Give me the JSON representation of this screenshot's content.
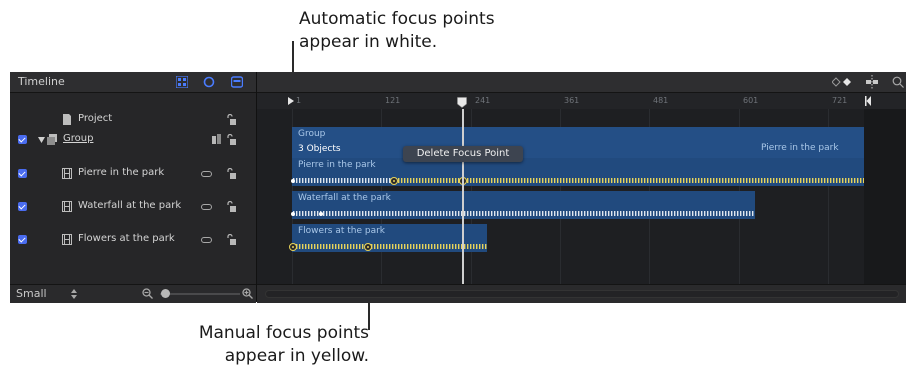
{
  "callouts": {
    "top_line1": "Automatic focus points",
    "top_line2": "appear in white.",
    "bottom_line1": "Manual focus points",
    "bottom_line2": "appear in yellow."
  },
  "timeline": {
    "title": "Timeline",
    "layers": [
      {
        "label": "Project",
        "checked": false
      },
      {
        "label": "Group",
        "checked": true
      },
      {
        "label": "Pierre in the park",
        "checked": true
      },
      {
        "label": "Waterfall at the park",
        "checked": true
      },
      {
        "label": "Flowers at the park",
        "checked": true
      }
    ],
    "size_label": "Small",
    "ruler_ticks": [
      "1",
      "121",
      "241",
      "361",
      "481",
      "601",
      "721"
    ],
    "group_bar_label": "Group",
    "group_count_label": "3 Objects",
    "group_trailing_label": "Pierre in the park",
    "clips": [
      "Pierre in the park",
      "Waterfall at the park",
      "Flowers at the park"
    ],
    "context_menu_item": "Delete Focus Point"
  },
  "colors": {
    "manual_focus_point": "#e8d35a",
    "automatic_focus_point": "#ffffff",
    "clip_bar": "#244f86",
    "checkbox": "#4a6cf0"
  }
}
